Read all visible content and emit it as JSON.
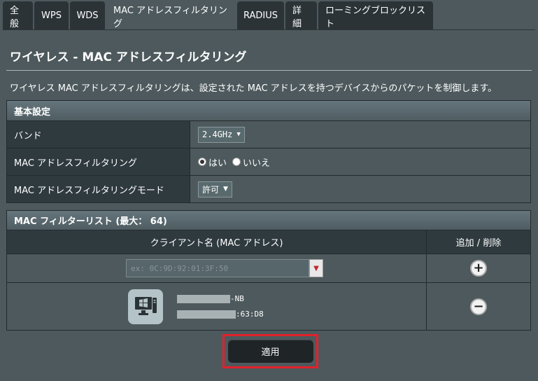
{
  "tabs": [
    {
      "label": "全般"
    },
    {
      "label": "WPS"
    },
    {
      "label": "WDS"
    },
    {
      "label": "MAC アドレスフィルタリング",
      "active": true
    },
    {
      "label": "RADIUS"
    },
    {
      "label": "詳細"
    },
    {
      "label": "ローミングブロックリスト"
    }
  ],
  "page": {
    "title": "ワイヤレス - MAC アドレスフィルタリング",
    "description": "ワイヤレス MAC アドレスフィルタリングは、設定された MAC アドレスを持つデバイスからのパケットを制御します。"
  },
  "basic": {
    "header": "基本設定",
    "band_label": "バンド",
    "band_value": "2.4GHz",
    "filter_label": "MAC アドレスフィルタリング",
    "filter_yes": "はい",
    "filter_no": "いいえ",
    "filter_selected": "yes",
    "mode_label": "MAC アドレスフィルタリングモード",
    "mode_value": "許可"
  },
  "list": {
    "header": "MAC フィルターリスト (最大： 64)",
    "col_client": "クライアント名 (MAC アドレス)",
    "col_action": "追加 / 削除",
    "mac_placeholder": "ex: 0C:9D:92:01:3F:50",
    "device_name_suffix": "-NB",
    "device_mac_suffix": ":63:D8"
  },
  "icons": {
    "add": "plus-circle-icon",
    "remove": "minus-circle-icon",
    "device": "windows-pc-icon",
    "dropdown": "triangle-down-icon"
  },
  "apply_label": "適用",
  "colors": {
    "background": "#4d595d",
    "tab_bg": "#2b3337",
    "label_bg": "#2f3a3f",
    "highlight": "#e3212a"
  }
}
